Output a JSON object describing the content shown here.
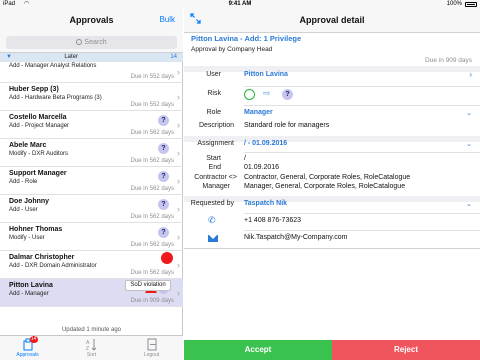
{
  "status_bar": {
    "carrier": "iPad",
    "time": "9:41 AM",
    "battery": "100%"
  },
  "left": {
    "nav_title": "Approvals",
    "bulk_label": "Bulk",
    "search_placeholder": "Search",
    "section": {
      "label": "Later",
      "count": "14"
    },
    "items": [
      {
        "name": "",
        "desc": "Add - Manager Analyst Relations",
        "due": "Due in 552 days"
      },
      {
        "name": "Huber Sepp (3)",
        "desc": "Add - Hardware Beta Programs (3)",
        "due": "Due in 552 days"
      },
      {
        "name": "Costello Marcella",
        "desc": "Add - Project Manager",
        "due": "Due in 562 days"
      },
      {
        "name": "Abele Marc",
        "desc": "Modify - DXR Auditors",
        "due": "Due in 562 days"
      },
      {
        "name": "Support Manager",
        "desc": "Add - Role",
        "due": "Due in 562 days"
      },
      {
        "name": "Doe Johnny",
        "desc": "Add - User",
        "due": "Due in 562 days"
      },
      {
        "name": "Hohner Thomas",
        "desc": "Modify - User",
        "due": "Due in 562 days"
      },
      {
        "name": "Dalmar Christopher",
        "desc": "Add - DXR Domain Administrator",
        "due": "Due in 562 days"
      },
      {
        "name": "Pitton Lavina",
        "desc": "Add - Manager",
        "due": "Due in 909 days"
      }
    ],
    "tooltip": "SoD violation",
    "updated": "Updated 1 minute ago",
    "tabs": [
      {
        "label": "Approvals",
        "badge": "14"
      },
      {
        "label": "Sort"
      },
      {
        "label": "Logout"
      }
    ]
  },
  "right": {
    "nav_title": "Approval detail",
    "header": {
      "title": "Pitton Lavina - Add: 1 Privilege",
      "subtitle": "Approval by Company Head",
      "due": "Due in 909 days"
    },
    "user": {
      "label": "User",
      "value": "Pitton Lavina"
    },
    "risk": {
      "label": "Risk"
    },
    "role": {
      "label": "Role",
      "value": "Manager"
    },
    "description": {
      "label": "Description",
      "value": "Standard role for managers"
    },
    "assignment": {
      "label": "Assignment",
      "value": "/ - 01.09.2016"
    },
    "start": {
      "label": "Start",
      "value": "/"
    },
    "end": {
      "label": "End",
      "value": "01.09.2016"
    },
    "contractor": {
      "label1": "Contractor <>",
      "label2": "Manager",
      "value1": "Contractor, General, Corporate Roles, RoleCatalogue",
      "value2": "Manager, General, Corporate Roles, RoleCatalogue"
    },
    "requested_by": {
      "label": "Requested by",
      "value": "Taspatch Nik"
    },
    "phone": "+1 408 876-73623",
    "email": "Nik.Taspatch@My-Company.com",
    "accept_label": "Accept",
    "reject_label": "Reject"
  },
  "colors": {
    "accent": "#007aff",
    "link": "#2a7ad6",
    "accept": "#3ac24e",
    "reject": "#f0555e",
    "selected_row": "#dcdcf2"
  },
  "icons": [
    "wifi-icon",
    "battery-icon",
    "expand-icon",
    "search-icon",
    "question-icon",
    "warning-icon",
    "chevron-right-icon",
    "chevron-down-icon",
    "phone-icon",
    "mail-icon",
    "approvals-tab-icon",
    "sort-tab-icon",
    "logout-tab-icon"
  ]
}
